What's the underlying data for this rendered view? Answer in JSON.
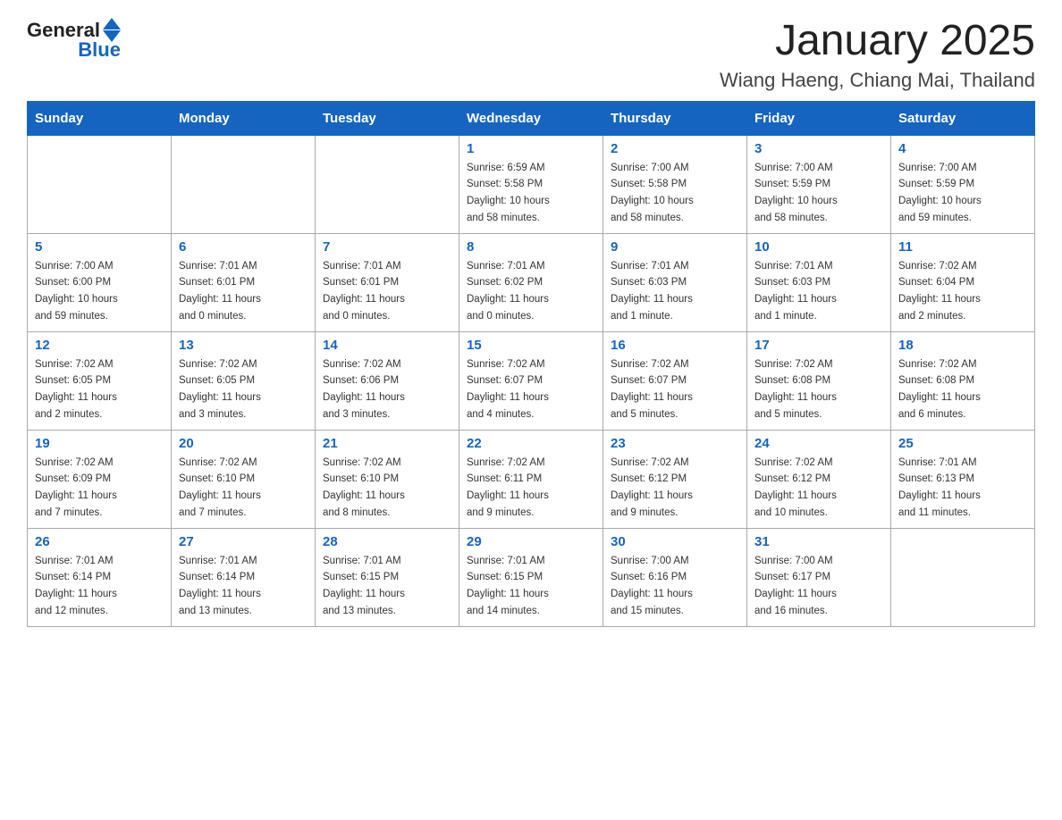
{
  "header": {
    "logo": {
      "general": "General",
      "blue": "Blue"
    },
    "title": "January 2025",
    "subtitle": "Wiang Haeng, Chiang Mai, Thailand"
  },
  "calendar": {
    "days_of_week": [
      "Sunday",
      "Monday",
      "Tuesday",
      "Wednesday",
      "Thursday",
      "Friday",
      "Saturday"
    ],
    "weeks": [
      [
        {
          "day": "",
          "info": ""
        },
        {
          "day": "",
          "info": ""
        },
        {
          "day": "",
          "info": ""
        },
        {
          "day": "1",
          "info": "Sunrise: 6:59 AM\nSunset: 5:58 PM\nDaylight: 10 hours\nand 58 minutes."
        },
        {
          "day": "2",
          "info": "Sunrise: 7:00 AM\nSunset: 5:58 PM\nDaylight: 10 hours\nand 58 minutes."
        },
        {
          "day": "3",
          "info": "Sunrise: 7:00 AM\nSunset: 5:59 PM\nDaylight: 10 hours\nand 58 minutes."
        },
        {
          "day": "4",
          "info": "Sunrise: 7:00 AM\nSunset: 5:59 PM\nDaylight: 10 hours\nand 59 minutes."
        }
      ],
      [
        {
          "day": "5",
          "info": "Sunrise: 7:00 AM\nSunset: 6:00 PM\nDaylight: 10 hours\nand 59 minutes."
        },
        {
          "day": "6",
          "info": "Sunrise: 7:01 AM\nSunset: 6:01 PM\nDaylight: 11 hours\nand 0 minutes."
        },
        {
          "day": "7",
          "info": "Sunrise: 7:01 AM\nSunset: 6:01 PM\nDaylight: 11 hours\nand 0 minutes."
        },
        {
          "day": "8",
          "info": "Sunrise: 7:01 AM\nSunset: 6:02 PM\nDaylight: 11 hours\nand 0 minutes."
        },
        {
          "day": "9",
          "info": "Sunrise: 7:01 AM\nSunset: 6:03 PM\nDaylight: 11 hours\nand 1 minute."
        },
        {
          "day": "10",
          "info": "Sunrise: 7:01 AM\nSunset: 6:03 PM\nDaylight: 11 hours\nand 1 minute."
        },
        {
          "day": "11",
          "info": "Sunrise: 7:02 AM\nSunset: 6:04 PM\nDaylight: 11 hours\nand 2 minutes."
        }
      ],
      [
        {
          "day": "12",
          "info": "Sunrise: 7:02 AM\nSunset: 6:05 PM\nDaylight: 11 hours\nand 2 minutes."
        },
        {
          "day": "13",
          "info": "Sunrise: 7:02 AM\nSunset: 6:05 PM\nDaylight: 11 hours\nand 3 minutes."
        },
        {
          "day": "14",
          "info": "Sunrise: 7:02 AM\nSunset: 6:06 PM\nDaylight: 11 hours\nand 3 minutes."
        },
        {
          "day": "15",
          "info": "Sunrise: 7:02 AM\nSunset: 6:07 PM\nDaylight: 11 hours\nand 4 minutes."
        },
        {
          "day": "16",
          "info": "Sunrise: 7:02 AM\nSunset: 6:07 PM\nDaylight: 11 hours\nand 5 minutes."
        },
        {
          "day": "17",
          "info": "Sunrise: 7:02 AM\nSunset: 6:08 PM\nDaylight: 11 hours\nand 5 minutes."
        },
        {
          "day": "18",
          "info": "Sunrise: 7:02 AM\nSunset: 6:08 PM\nDaylight: 11 hours\nand 6 minutes."
        }
      ],
      [
        {
          "day": "19",
          "info": "Sunrise: 7:02 AM\nSunset: 6:09 PM\nDaylight: 11 hours\nand 7 minutes."
        },
        {
          "day": "20",
          "info": "Sunrise: 7:02 AM\nSunset: 6:10 PM\nDaylight: 11 hours\nand 7 minutes."
        },
        {
          "day": "21",
          "info": "Sunrise: 7:02 AM\nSunset: 6:10 PM\nDaylight: 11 hours\nand 8 minutes."
        },
        {
          "day": "22",
          "info": "Sunrise: 7:02 AM\nSunset: 6:11 PM\nDaylight: 11 hours\nand 9 minutes."
        },
        {
          "day": "23",
          "info": "Sunrise: 7:02 AM\nSunset: 6:12 PM\nDaylight: 11 hours\nand 9 minutes."
        },
        {
          "day": "24",
          "info": "Sunrise: 7:02 AM\nSunset: 6:12 PM\nDaylight: 11 hours\nand 10 minutes."
        },
        {
          "day": "25",
          "info": "Sunrise: 7:01 AM\nSunset: 6:13 PM\nDaylight: 11 hours\nand 11 minutes."
        }
      ],
      [
        {
          "day": "26",
          "info": "Sunrise: 7:01 AM\nSunset: 6:14 PM\nDaylight: 11 hours\nand 12 minutes."
        },
        {
          "day": "27",
          "info": "Sunrise: 7:01 AM\nSunset: 6:14 PM\nDaylight: 11 hours\nand 13 minutes."
        },
        {
          "day": "28",
          "info": "Sunrise: 7:01 AM\nSunset: 6:15 PM\nDaylight: 11 hours\nand 13 minutes."
        },
        {
          "day": "29",
          "info": "Sunrise: 7:01 AM\nSunset: 6:15 PM\nDaylight: 11 hours\nand 14 minutes."
        },
        {
          "day": "30",
          "info": "Sunrise: 7:00 AM\nSunset: 6:16 PM\nDaylight: 11 hours\nand 15 minutes."
        },
        {
          "day": "31",
          "info": "Sunrise: 7:00 AM\nSunset: 6:17 PM\nDaylight: 11 hours\nand 16 minutes."
        },
        {
          "day": "",
          "info": ""
        }
      ]
    ]
  }
}
